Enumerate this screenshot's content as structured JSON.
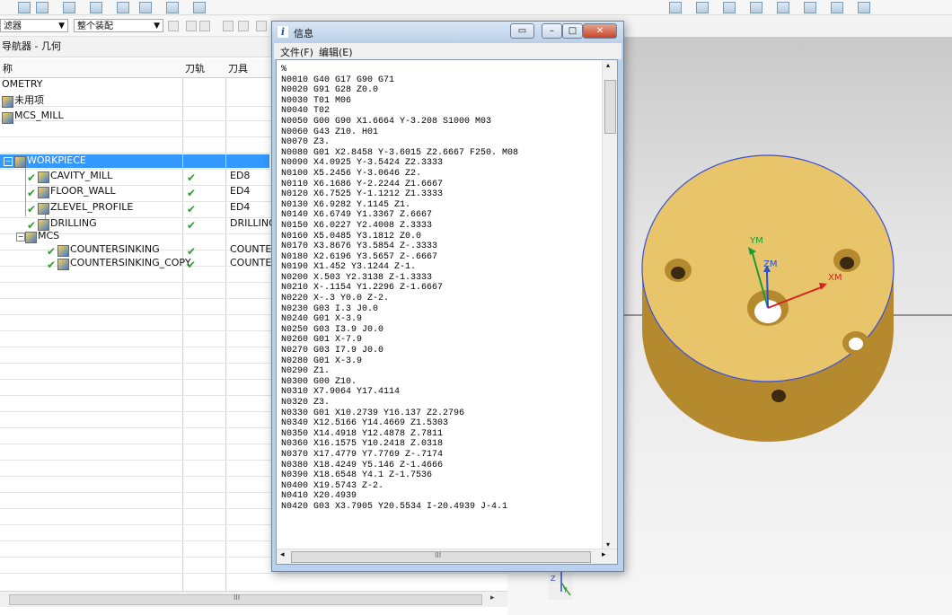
{
  "filter": {
    "combo1": "滤器",
    "combo2": "整个装配"
  },
  "navigator": {
    "title": "导航器 - 几何",
    "columns": {
      "name": "称",
      "path": "刀轨",
      "tool": "刀具"
    },
    "rows": [
      {
        "name": "OMETRY",
        "tool": "",
        "checked": false
      },
      {
        "name": "未用项",
        "tool": "",
        "checked": false
      },
      {
        "name": "MCS_MILL",
        "tool": "",
        "checked": false
      },
      {
        "name": "WORKPIECE",
        "tool": "",
        "checked": false,
        "selected": true
      },
      {
        "name": "CAVITY_MILL",
        "tool": "ED8",
        "checked": true
      },
      {
        "name": "FLOOR_WALL",
        "tool": "ED4",
        "checked": true
      },
      {
        "name": "ZLEVEL_PROFILE",
        "tool": "ED4",
        "checked": true
      },
      {
        "name": "DRILLING",
        "tool": "DRILLING",
        "checked": true
      },
      {
        "name": "MCS",
        "tool": "",
        "checked": false
      },
      {
        "name": "COUNTERSINKING",
        "tool": "COUNTER",
        "checked": true
      },
      {
        "name": "COUNTERSINKING_COPY",
        "tool": "COUNTER",
        "checked": true
      }
    ],
    "hscroll_glyph": "III"
  },
  "info_window": {
    "title": "信息",
    "menu": [
      "文件(F)",
      "编辑(E)"
    ],
    "hscroll_glyph": "III",
    "lines": [
      "%",
      "N0010 G40 G17 G90 G71",
      "N0020 G91 G28 Z0.0",
      "N0030 T01 M06",
      "N0040 T02",
      "N0050 G00 G90 X1.6664 Y-3.208 S1000 M03",
      "N0060 G43 Z10. H01",
      "N0070 Z3.",
      "N0080 G01 X2.8458 Y-3.6015 Z2.6667 F250. M08",
      "N0090 X4.0925 Y-3.5424 Z2.3333",
      "N0100 X5.2456 Y-3.0646 Z2.",
      "N0110 X6.1686 Y-2.2244 Z1.6667",
      "N0120 X6.7525 Y-1.1212 Z1.3333",
      "N0130 X6.9282 Y.1145 Z1.",
      "N0140 X6.6749 Y1.3367 Z.6667",
      "N0150 X6.0227 Y2.4008 Z.3333",
      "N0160 X5.0485 Y3.1812 Z0.0",
      "N0170 X3.8676 Y3.5854 Z-.3333",
      "N0180 X2.6196 Y3.5657 Z-.6667",
      "N0190 X1.452 Y3.1244 Z-1.",
      "N0200 X.503 Y2.3138 Z-1.3333",
      "N0210 X-.1154 Y1.2296 Z-1.6667",
      "N0220 X-.3 Y0.0 Z-2.",
      "N0230 G03 I.3 J0.0",
      "N0240 G01 X-3.9",
      "N0250 G03 I3.9 J0.0",
      "N0260 G01 X-7.9",
      "N0270 G03 I7.9 J0.0",
      "N0280 G01 X-3.9",
      "N0290 Z1.",
      "N0300 G00 Z10.",
      "N0310 X7.9064 Y17.4114",
      "N0320 Z3.",
      "N0330 G01 X10.2739 Y16.137 Z2.2796",
      "N0340 X12.5166 Y14.4669 Z1.5303",
      "N0350 X14.4918 Y12.4878 Z.7811",
      "N0360 X16.1575 Y10.2418 Z.0318",
      "N0370 X17.4779 Y7.7769 Z-.7174",
      "N0380 X18.4249 Y5.146 Z-1.4666",
      "N0390 X18.6548 Y4.1 Z-1.7536",
      "N0400 X19.5743 Z-2.",
      "N0410 X20.4939",
      "N0420 G03 X3.7905 Y20.5534 I-20.4939 J-4.1"
    ]
  },
  "viewport": {
    "axis_labels": {
      "ym": "YM",
      "zm": "ZM",
      "xm": "XM"
    },
    "triad_labels": {
      "z": "Z",
      "y": "Y"
    },
    "part_color": "#e8c56a",
    "edge_color": "#3a4fd8"
  }
}
